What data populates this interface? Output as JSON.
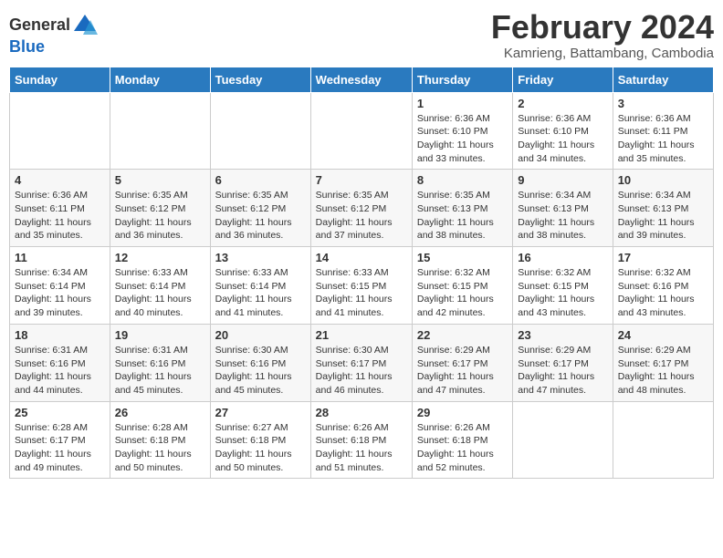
{
  "header": {
    "logo_general": "General",
    "logo_blue": "Blue",
    "month_year": "February 2024",
    "location": "Kamrieng, Battambang, Cambodia"
  },
  "columns": [
    "Sunday",
    "Monday",
    "Tuesday",
    "Wednesday",
    "Thursday",
    "Friday",
    "Saturday"
  ],
  "weeks": [
    [
      {
        "day": "",
        "info": ""
      },
      {
        "day": "",
        "info": ""
      },
      {
        "day": "",
        "info": ""
      },
      {
        "day": "",
        "info": ""
      },
      {
        "day": "1",
        "info": "Sunrise: 6:36 AM\nSunset: 6:10 PM\nDaylight: 11 hours and 33 minutes."
      },
      {
        "day": "2",
        "info": "Sunrise: 6:36 AM\nSunset: 6:10 PM\nDaylight: 11 hours and 34 minutes."
      },
      {
        "day": "3",
        "info": "Sunrise: 6:36 AM\nSunset: 6:11 PM\nDaylight: 11 hours and 35 minutes."
      }
    ],
    [
      {
        "day": "4",
        "info": "Sunrise: 6:36 AM\nSunset: 6:11 PM\nDaylight: 11 hours and 35 minutes."
      },
      {
        "day": "5",
        "info": "Sunrise: 6:35 AM\nSunset: 6:12 PM\nDaylight: 11 hours and 36 minutes."
      },
      {
        "day": "6",
        "info": "Sunrise: 6:35 AM\nSunset: 6:12 PM\nDaylight: 11 hours and 36 minutes."
      },
      {
        "day": "7",
        "info": "Sunrise: 6:35 AM\nSunset: 6:12 PM\nDaylight: 11 hours and 37 minutes."
      },
      {
        "day": "8",
        "info": "Sunrise: 6:35 AM\nSunset: 6:13 PM\nDaylight: 11 hours and 38 minutes."
      },
      {
        "day": "9",
        "info": "Sunrise: 6:34 AM\nSunset: 6:13 PM\nDaylight: 11 hours and 38 minutes."
      },
      {
        "day": "10",
        "info": "Sunrise: 6:34 AM\nSunset: 6:13 PM\nDaylight: 11 hours and 39 minutes."
      }
    ],
    [
      {
        "day": "11",
        "info": "Sunrise: 6:34 AM\nSunset: 6:14 PM\nDaylight: 11 hours and 39 minutes."
      },
      {
        "day": "12",
        "info": "Sunrise: 6:33 AM\nSunset: 6:14 PM\nDaylight: 11 hours and 40 minutes."
      },
      {
        "day": "13",
        "info": "Sunrise: 6:33 AM\nSunset: 6:14 PM\nDaylight: 11 hours and 41 minutes."
      },
      {
        "day": "14",
        "info": "Sunrise: 6:33 AM\nSunset: 6:15 PM\nDaylight: 11 hours and 41 minutes."
      },
      {
        "day": "15",
        "info": "Sunrise: 6:32 AM\nSunset: 6:15 PM\nDaylight: 11 hours and 42 minutes."
      },
      {
        "day": "16",
        "info": "Sunrise: 6:32 AM\nSunset: 6:15 PM\nDaylight: 11 hours and 43 minutes."
      },
      {
        "day": "17",
        "info": "Sunrise: 6:32 AM\nSunset: 6:16 PM\nDaylight: 11 hours and 43 minutes."
      }
    ],
    [
      {
        "day": "18",
        "info": "Sunrise: 6:31 AM\nSunset: 6:16 PM\nDaylight: 11 hours and 44 minutes."
      },
      {
        "day": "19",
        "info": "Sunrise: 6:31 AM\nSunset: 6:16 PM\nDaylight: 11 hours and 45 minutes."
      },
      {
        "day": "20",
        "info": "Sunrise: 6:30 AM\nSunset: 6:16 PM\nDaylight: 11 hours and 45 minutes."
      },
      {
        "day": "21",
        "info": "Sunrise: 6:30 AM\nSunset: 6:17 PM\nDaylight: 11 hours and 46 minutes."
      },
      {
        "day": "22",
        "info": "Sunrise: 6:29 AM\nSunset: 6:17 PM\nDaylight: 11 hours and 47 minutes."
      },
      {
        "day": "23",
        "info": "Sunrise: 6:29 AM\nSunset: 6:17 PM\nDaylight: 11 hours and 47 minutes."
      },
      {
        "day": "24",
        "info": "Sunrise: 6:29 AM\nSunset: 6:17 PM\nDaylight: 11 hours and 48 minutes."
      }
    ],
    [
      {
        "day": "25",
        "info": "Sunrise: 6:28 AM\nSunset: 6:17 PM\nDaylight: 11 hours and 49 minutes."
      },
      {
        "day": "26",
        "info": "Sunrise: 6:28 AM\nSunset: 6:18 PM\nDaylight: 11 hours and 50 minutes."
      },
      {
        "day": "27",
        "info": "Sunrise: 6:27 AM\nSunset: 6:18 PM\nDaylight: 11 hours and 50 minutes."
      },
      {
        "day": "28",
        "info": "Sunrise: 6:26 AM\nSunset: 6:18 PM\nDaylight: 11 hours and 51 minutes."
      },
      {
        "day": "29",
        "info": "Sunrise: 6:26 AM\nSunset: 6:18 PM\nDaylight: 11 hours and 52 minutes."
      },
      {
        "day": "",
        "info": ""
      },
      {
        "day": "",
        "info": ""
      }
    ]
  ]
}
